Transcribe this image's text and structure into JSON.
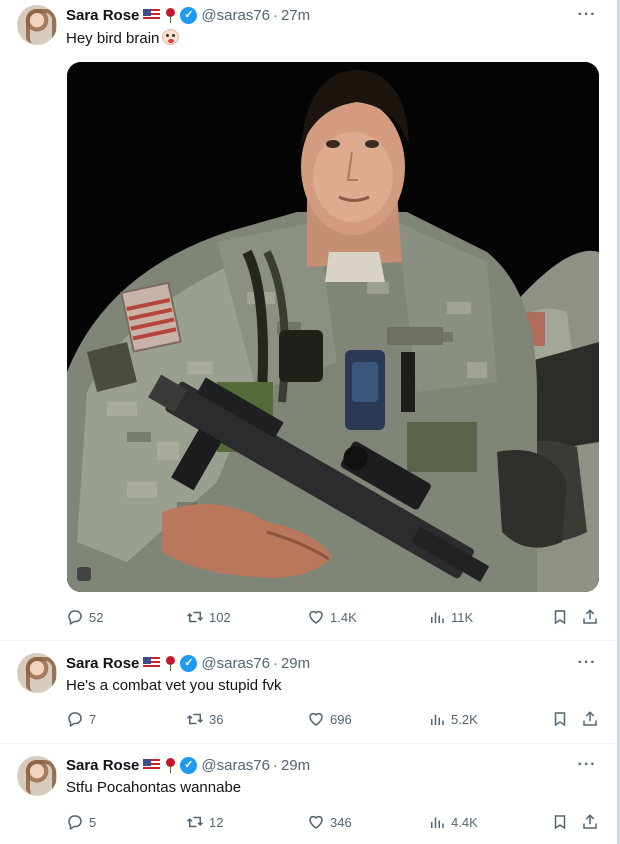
{
  "tweets": [
    {
      "author": "Sara Rose",
      "handle": "@saras76",
      "sep": "·",
      "time": "27m",
      "text": "Hey bird brain",
      "has_emoji": true,
      "has_media": true,
      "stats": {
        "replies": "52",
        "retweets": "102",
        "likes": "1.4K",
        "views": "11K"
      }
    },
    {
      "author": "Sara Rose",
      "handle": "@saras76",
      "sep": "·",
      "time": "29m",
      "text": "He's a combat vet you stupid fvk",
      "has_emoji": false,
      "has_media": false,
      "stats": {
        "replies": "7",
        "retweets": "36",
        "likes": "696",
        "views": "5.2K"
      }
    },
    {
      "author": "Sara Rose",
      "handle": "@saras76",
      "sep": "·",
      "time": "29m",
      "text": "Stfu Pocahontas wannabe",
      "has_emoji": false,
      "has_media": false,
      "stats": {
        "replies": "5",
        "retweets": "12",
        "likes": "346",
        "views": "4.4K"
      }
    }
  ],
  "ui": {
    "more": "···",
    "verified_mark": "✓"
  },
  "icons": [
    "reply-icon",
    "retweet-icon",
    "like-icon",
    "views-icon",
    "bookmark-icon",
    "share-icon",
    "more-icon",
    "verified-icon",
    "us-flag-icon",
    "rose-icon",
    "clown-emoji"
  ],
  "colors": {
    "text": "#0f1419",
    "secondary": "#536471",
    "verified": "#1d9bf0",
    "divider": "#eff3f4"
  }
}
